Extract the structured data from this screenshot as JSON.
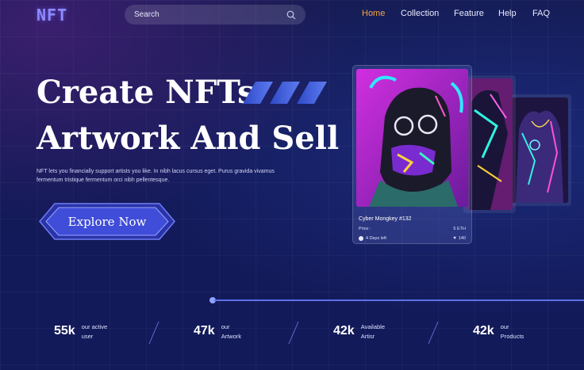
{
  "brand": {
    "logo": "NFT"
  },
  "search": {
    "placeholder": "Search"
  },
  "nav": {
    "items": [
      {
        "label": "Home",
        "active": true
      },
      {
        "label": "Collection",
        "active": false
      },
      {
        "label": "Feature",
        "active": false
      },
      {
        "label": "Help",
        "active": false
      },
      {
        "label": "FAQ",
        "active": false
      }
    ]
  },
  "hero": {
    "title_line1": "Create NFTs",
    "title_line2": "Artwork And Sell",
    "description": "NFT lets you financially support artists you like. In nibh lacus cursus eget. Purus gravida vivamus fermentum tristique fermentum orci nibh pellentesque.",
    "cta_label": "Explore Now"
  },
  "card": {
    "name": "Cyber Mongkey #132",
    "price_label": "Price :",
    "price_value": "5 ETH",
    "time_left": "4 Days left",
    "likes": "140"
  },
  "stats": [
    {
      "value": "55k",
      "label_line1": "our active",
      "label_line2": "user"
    },
    {
      "value": "47k",
      "label_line1": "our",
      "label_line2": "Artwork"
    },
    {
      "value": "42k",
      "label_line1": "Available",
      "label_line2": "Artisr"
    },
    {
      "value": "42k",
      "label_line1": "our",
      "label_line2": "Products"
    }
  ],
  "colors": {
    "accent_active_nav": "#f4a640",
    "logo": "#8e8bff",
    "button_fill": "#3f4dd8",
    "divider": "#5b71e6",
    "background": "#141a56"
  },
  "icons": {
    "search": "search-icon",
    "clock": "clock-icon",
    "heart": "heart-icon"
  }
}
